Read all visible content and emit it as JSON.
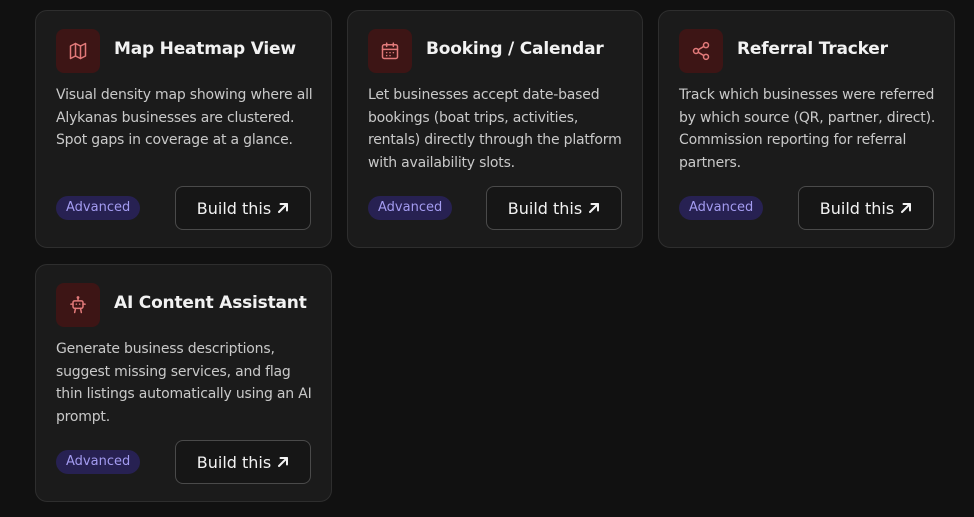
{
  "cards": [
    {
      "icon": "map-icon",
      "title": "Map Heatmap View",
      "description": "Visual density map showing where all Alykanas businesses are clustered. Spot gaps in coverage at a glance.",
      "badge": "Advanced",
      "button_label": "Build this"
    },
    {
      "icon": "calendar-icon",
      "title": "Booking / Calendar",
      "description": "Let businesses accept date-based bookings (boat trips, activities, rentals) directly through the platform with availability slots.",
      "badge": "Advanced",
      "button_label": "Build this"
    },
    {
      "icon": "share-icon",
      "title": "Referral Tracker",
      "description": "Track which businesses were referred by which source (QR, partner, direct). Commission reporting for referral partners.",
      "badge": "Advanced",
      "button_label": "Build this"
    },
    {
      "icon": "bot-icon",
      "title": "AI Content Assistant",
      "description": "Generate business descriptions, suggest missing services, and flag thin listings automatically using an AI prompt.",
      "badge": "Advanced",
      "button_label": "Build this"
    }
  ],
  "colors": {
    "background": "#111111",
    "card": "#1b1b1b",
    "icon_bg": "#3d1515",
    "icon_stroke": "#e27a7a",
    "badge_bg": "#272152",
    "badge_text": "#a39bf0"
  }
}
